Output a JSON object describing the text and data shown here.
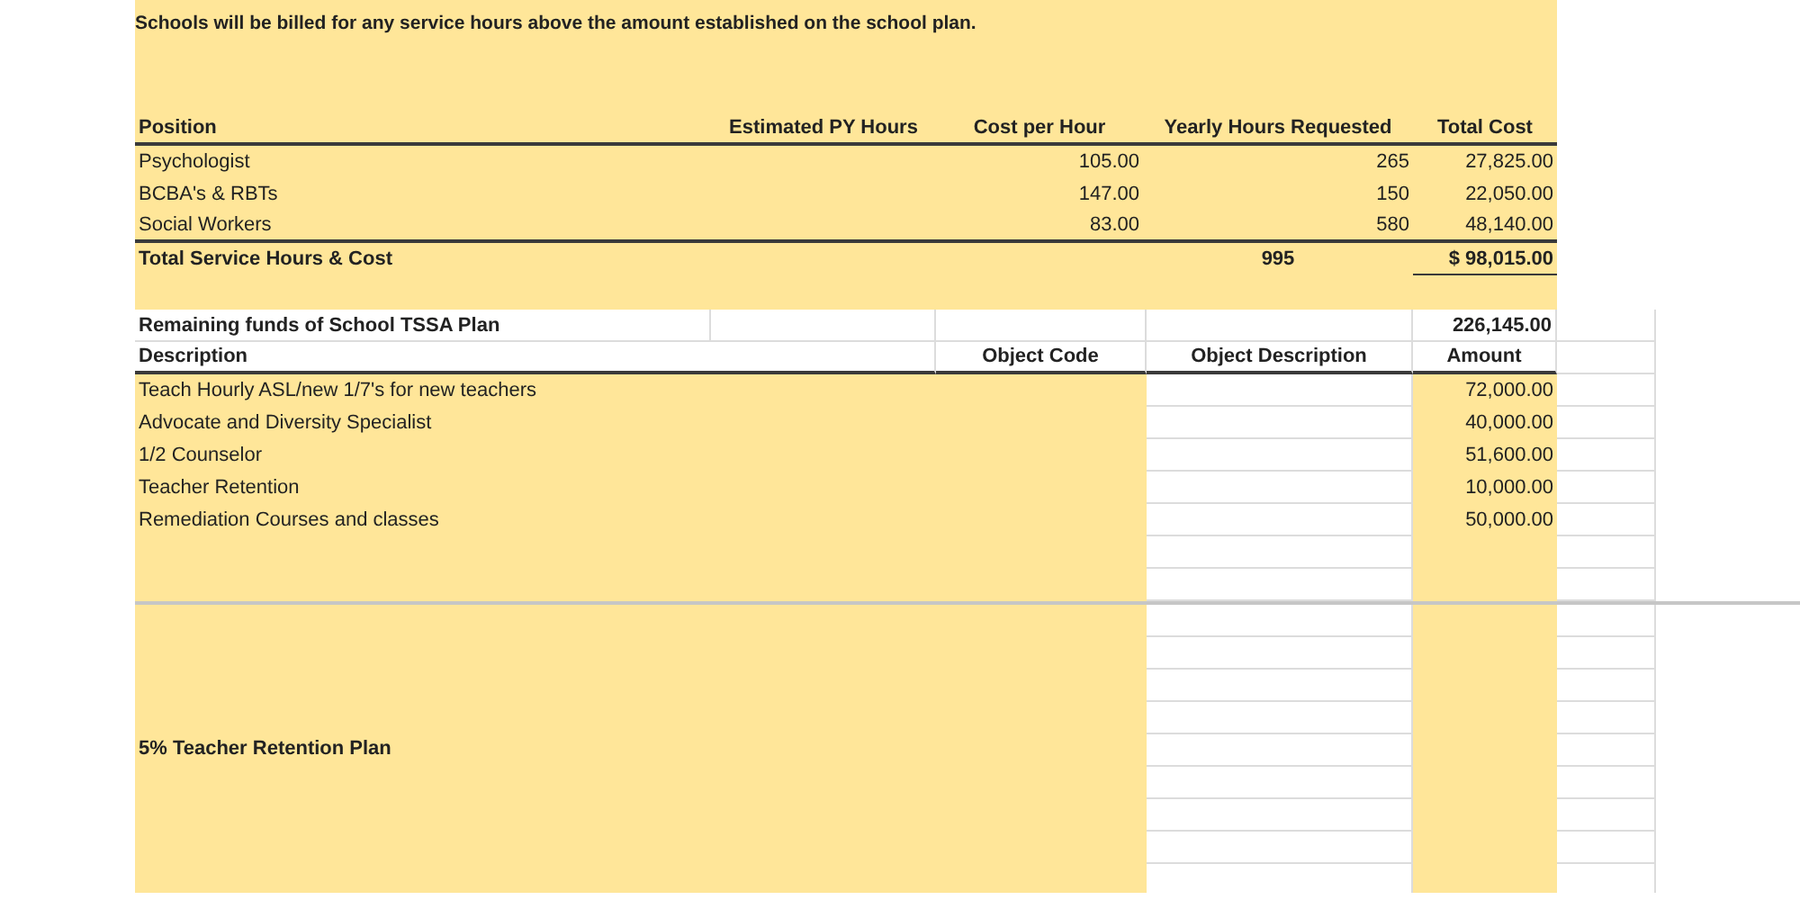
{
  "notice": "Schools will be billed for any service hours above the amount established on the school plan.",
  "services": {
    "columns": [
      "Position",
      "Estimated PY Hours",
      "Cost per Hour",
      "Yearly Hours Requested",
      "Total Cost"
    ],
    "rows": [
      {
        "position": "Psychologist",
        "cost_per_hour": "105.00",
        "yearly_hours": "265",
        "total_cost": "27,825.00"
      },
      {
        "position": "BCBA's & RBTs",
        "cost_per_hour": "147.00",
        "yearly_hours": "150",
        "total_cost": "22,050.00"
      },
      {
        "position": "Social Workers",
        "cost_per_hour": "83.00",
        "yearly_hours": "580",
        "total_cost": "48,140.00"
      }
    ],
    "total": {
      "label": "Total Service Hours & Cost",
      "yearly_hours": "995",
      "total_cost": "$ 98,015.00"
    }
  },
  "funds": {
    "label": "Remaining funds of School TSSA Plan",
    "amount": "226,145.00",
    "columns": [
      "Description",
      "Object Code",
      "Object Description",
      "Amount"
    ],
    "rows": [
      {
        "description": "Teach Hourly ASL/new 1/7's for new teachers",
        "amount": "72,000.00"
      },
      {
        "description": "Advocate and Diversity Specialist",
        "amount": "40,000.00"
      },
      {
        "description": "1/2 Counselor",
        "amount": "51,600.00"
      },
      {
        "description": "Teacher Retention",
        "amount": "10,000.00"
      },
      {
        "description": "Remediation Courses and classes",
        "amount": "50,000.00"
      }
    ],
    "plan_label": "5% Teacher Retention Plan"
  }
}
